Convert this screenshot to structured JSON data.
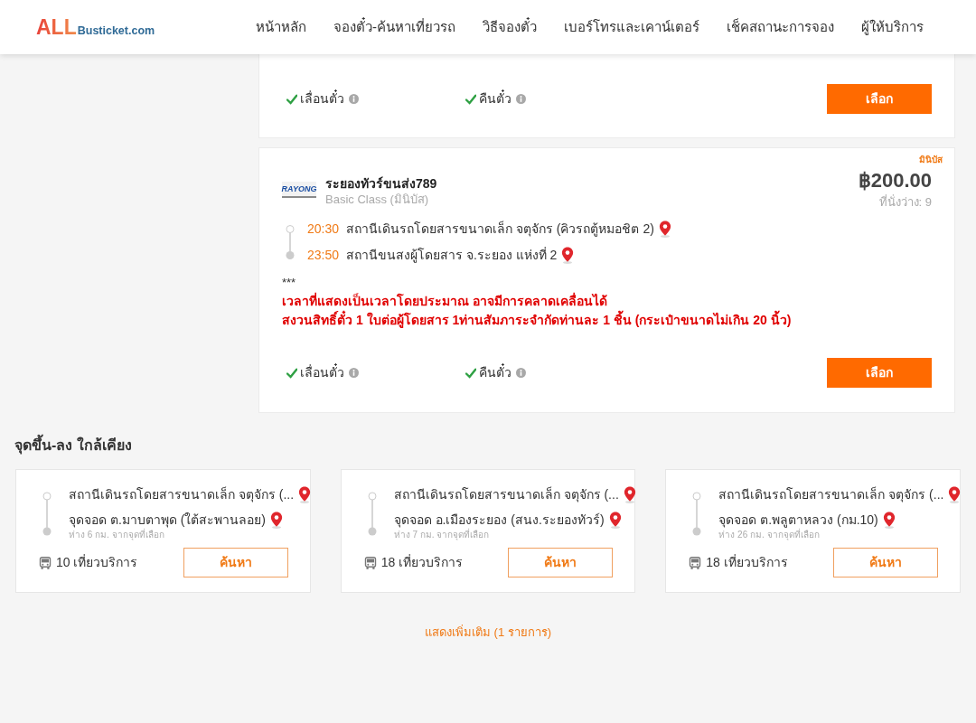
{
  "header": {
    "logo": {
      "primary": "ALL",
      "secondary": "Busticket.com"
    },
    "nav": [
      {
        "label": "หน้าหลัก"
      },
      {
        "label": "จองตั๋ว-ค้นหาเที่ยวรถ"
      },
      {
        "label": "วิธีจองตั๋ว"
      },
      {
        "label": "เบอร์โทรและเคาน์เตอร์"
      },
      {
        "label": "เช็คสถานะการจอง"
      },
      {
        "label": "ผู้ให้บริการ"
      }
    ]
  },
  "trips": [
    {
      "features": [
        {
          "label": "เลื่อนตั๋ว",
          "available": true
        },
        {
          "label": "คืนตั๋ว",
          "available": true
        }
      ],
      "button": "เลือก"
    },
    {
      "vehicle_type": "มินิบัส",
      "operator": {
        "logo": "RAYONG",
        "name": "ระยองทัวร์ขนส่ง789",
        "class": "Basic Class (มินิบัส)"
      },
      "price": "฿200.00",
      "seats": "ที่นั่งว่าง: 9",
      "stops": [
        {
          "time": "20:30",
          "name": "สถานีเดินรถโดยสารขนาดเล็ก จตุจักร (คิวรถตู้หมอชิต 2)"
        },
        {
          "time": "23:50",
          "name": "สถานีขนสงผู้โดยสาร จ.ระยอง แห่งที่ 2"
        }
      ],
      "note_marker": "***",
      "notes": [
        "เวลาที่แสดงเป็นเวลาโดยประมาณ อาจมีการคลาดเคลื่อนได้",
        "สงวนสิทธิ์ตั๋ว 1 ใบต่อผู้โดยสาร 1ท่านสัมภาระจำกัดท่านละ 1 ชิ้น (กระเป๋าขนาดไม่เกิน 20 นิ้ว)"
      ],
      "features": [
        {
          "label": "เลื่อนตั๋ว",
          "available": true
        },
        {
          "label": "คืนตั๋ว",
          "available": true
        }
      ],
      "button": "เลือก"
    }
  ],
  "nearby": {
    "title": "จุดขึ้น-ลง ใกล้เคียง",
    "routes": [
      {
        "from": "สถานีเดินรถโดยสารขนาดเล็ก จตุจักร (...",
        "to": "จุดจอด ต.มาบตาพุด (ใต้สะพานลอย)",
        "distance": "ห่าง 6 กม. จากจุดที่เลือก",
        "trips": "10 เที่ยวบริการ",
        "button": "ค้นหา"
      },
      {
        "from": "สถานีเดินรถโดยสารขนาดเล็ก จตุจักร (...",
        "to": "จุดจอด อ.เมืองระยอง (สนง.ระยองทัวร์)",
        "distance": "ห่าง 7 กม. จากจุดที่เลือก",
        "trips": "18 เที่ยวบริการ",
        "button": "ค้นหา"
      },
      {
        "from": "สถานีเดินรถโดยสารขนาดเล็ก จตุจักร (...",
        "to": "จุดจอด ต.พลูตาหลวง (กม.10)",
        "distance": "ห่าง 26 กม. จากจุดที่เลือก",
        "trips": "18 เที่ยวบริการ",
        "button": "ค้นหา"
      }
    ]
  },
  "show_more": "แสดงเพิ่มเติม (1 รายการ)"
}
